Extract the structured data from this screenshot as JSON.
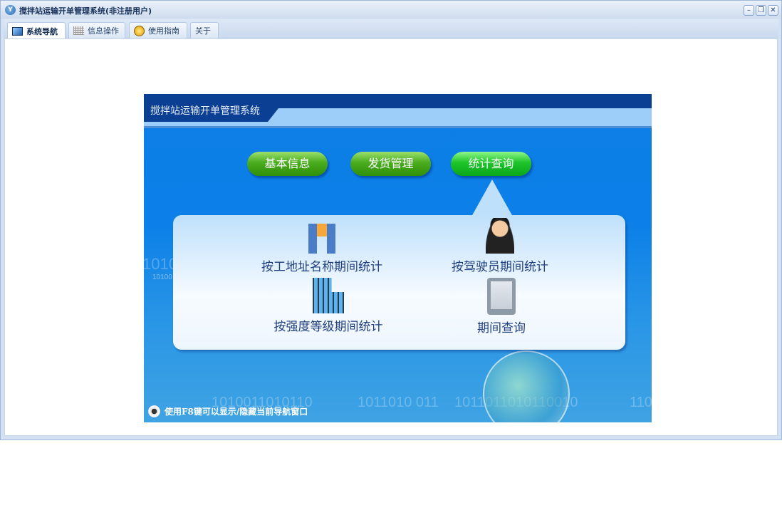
{
  "window": {
    "title": "搅拌站运输开单管理系统(非注册用户)",
    "app_icon_letter": "Y",
    "minimize": "–",
    "restore": "❐",
    "close": "✕"
  },
  "tabs": [
    {
      "label": "系统导航",
      "icon": "monitor-icon"
    },
    {
      "label": "信息操作",
      "icon": "grid-icon"
    },
    {
      "label": "使用指南",
      "icon": "help-icon"
    },
    {
      "label": "关于"
    }
  ],
  "banner": {
    "title": "搅拌站运输开单管理系统",
    "buttons": [
      {
        "label": "基本信息"
      },
      {
        "label": "发货管理"
      },
      {
        "label": "统计查询",
        "active": true
      }
    ],
    "items": [
      {
        "label": "按工地址名称期间统计",
        "icon": "binoculars-icon"
      },
      {
        "label": "按驾驶员期间统计",
        "icon": "driver-icon"
      },
      {
        "label": "按强度等级期间统计",
        "icon": "building-icon"
      },
      {
        "label": "期间查询",
        "icon": "pendulum-icon"
      }
    ],
    "binary_bg": [
      "1010",
      "10100",
      "1010011010110",
      "1011010  011",
      "1011011010110010",
      "110"
    ],
    "tip": "使用F8键可以显示/隐藏当前导航窗口"
  }
}
